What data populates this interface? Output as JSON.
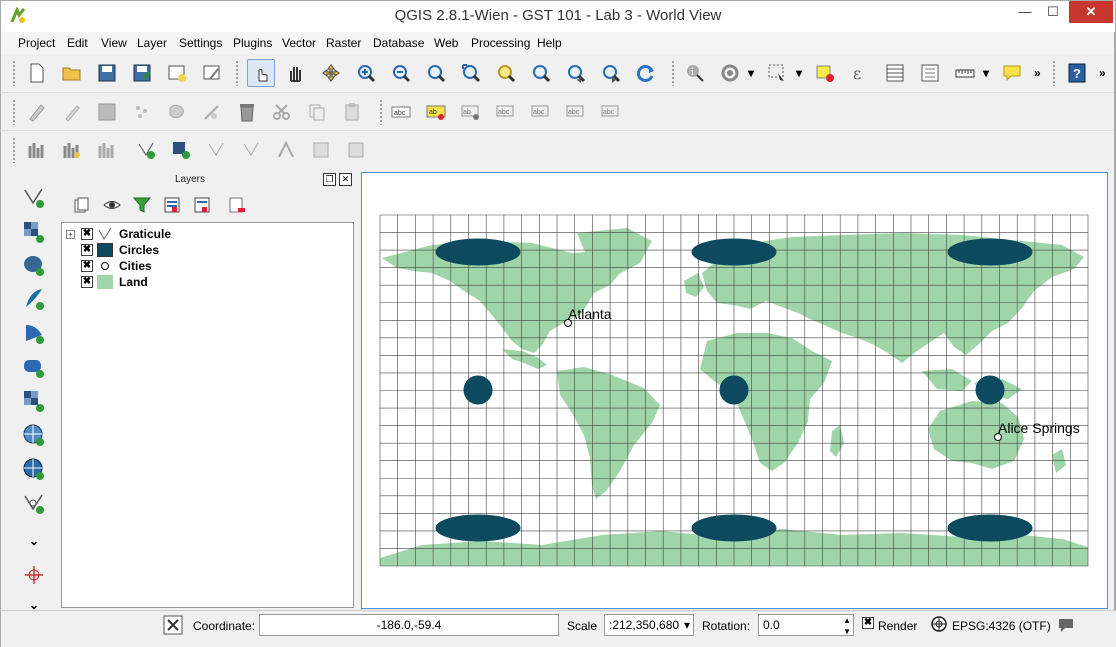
{
  "window": {
    "title": "QGIS 2.8.1-Wien - GST 101 - Lab 3 - World View",
    "min": "—",
    "max": "☐",
    "close": "✕"
  },
  "menu": [
    "Project",
    "Edit",
    "View",
    "Layer",
    "Settings",
    "Plugins",
    "Vector",
    "Raster",
    "Database",
    "Web",
    "Processing",
    "Help"
  ],
  "layers_panel": {
    "title": "Layers",
    "float_btn": "❐",
    "close_btn": "✕",
    "layers": [
      {
        "name": "Graticule",
        "checked": "✖",
        "expander": "+",
        "symbol": "line-vector-icon"
      },
      {
        "name": "Circles",
        "checked": "✖",
        "symbol": "fill",
        "color": "#0d4a5f"
      },
      {
        "name": "Cities",
        "checked": "✖",
        "symbol": "point"
      },
      {
        "name": "Land",
        "checked": "✖",
        "symbol": "fill",
        "color": "#9fd5a8"
      }
    ]
  },
  "map": {
    "land_color": "#9fd5a8",
    "circle_color": "#0d4a5f",
    "grid_color": "#444444",
    "cities": [
      {
        "name": "Atlanta"
      },
      {
        "name": "Alice Springs"
      }
    ]
  },
  "statusbar": {
    "coordinate_label": "Coordinate:",
    "coordinate_value": "-186.0,-59.4",
    "scale_label": "Scale",
    "scale_value": ":212,350,680",
    "rotation_label": "Rotation:",
    "rotation_value": "0.0",
    "render_label": "Render",
    "render_checked": "✖",
    "crs": "EPSG:4326 (OTF)"
  },
  "toolbar_more": "»",
  "vtoolbar_more": "»"
}
